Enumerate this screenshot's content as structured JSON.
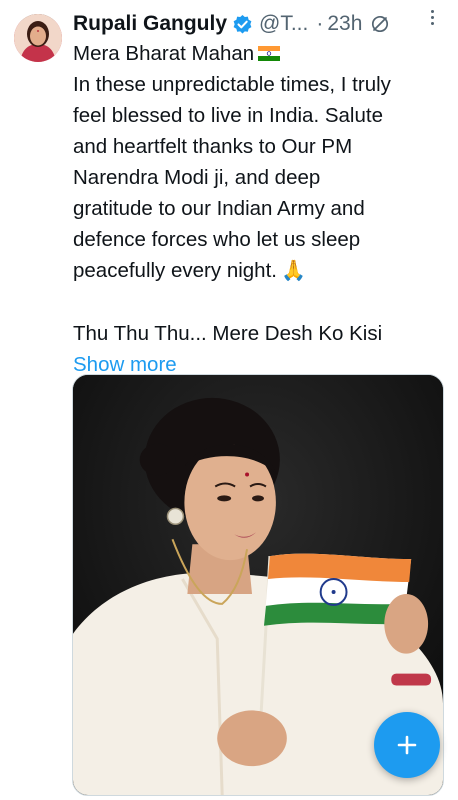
{
  "tweet": {
    "author_name": "Rupali Ganguly",
    "handle": "@T...",
    "separator": "·",
    "time": "23h",
    "lines": [
      "Mera Bharat Mahan",
      "In these unpredictable times, I truly",
      "feel blessed to live in India. Salute",
      "and heartfelt thanks to Our PM",
      "Narendra Modi ji, and deep",
      "gratitude to our Indian Army and",
      "defence forces who let us sleep",
      "peacefully every night.",
      "Thu Thu Thu... Mere Desh Ko Kisi"
    ],
    "show_more_label": "Show more",
    "pray_emoji": "🙏"
  },
  "icons": {
    "verified": "verified-badge-icon",
    "edited": "edited-icon",
    "more": "more-options-icon",
    "compose": "compose-plus-icon",
    "flag": "india-flag-icon"
  },
  "colors": {
    "accent": "#1d9bf0",
    "text": "#0f1419",
    "secondary": "#536471"
  }
}
